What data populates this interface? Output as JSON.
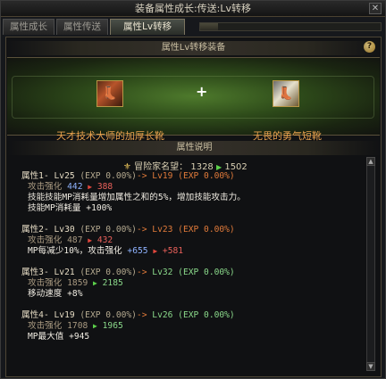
{
  "window": {
    "title": "装备属性成长:传送:Lv转移"
  },
  "tabs": [
    "属性成长",
    "属性传送",
    "属性Lv转移"
  ],
  "tab_progress": 0.1,
  "equip_section": {
    "title": "属性Lv转移装备",
    "left_item": {
      "name": "天才技术大师的加厚长靴",
      "icon": "boot-icon"
    },
    "right_item": {
      "name": "无畏的勇气短靴",
      "icon": "boot-icon"
    },
    "plus": "+"
  },
  "detail_section": {
    "title": "属性说明",
    "fame": {
      "label": "冒险家名望：",
      "from": "1328",
      "to": "1502"
    },
    "attributes": [
      {
        "head": "属性1- Lv25",
        "exp_from": "(EXP 0.00%)",
        "arrow": "->",
        "target": "Lv19 (EXP 0.00%)",
        "lines": [
          {
            "label": "攻击强化",
            "from": "442",
            "dir": "down",
            "to": "388"
          },
          {
            "text": "技能技能MP消耗量增加属性之和的5%，增加技能攻击力。"
          },
          {
            "text": "技能MP消耗量 +100%"
          }
        ]
      },
      {
        "head": "属性2- Lv30",
        "exp_from": "(EXP 0.00%)",
        "arrow": "->",
        "target": "Lv23 (EXP 0.00%)",
        "lines": [
          {
            "label": "攻击强化",
            "from": "487",
            "dir": "down",
            "to": "432"
          },
          {
            "text": "MP每减少10%，攻击强化",
            "extra_from": "+655",
            "extra_to": "+581"
          }
        ]
      },
      {
        "head": "属性3- Lv21",
        "exp_from": "(EXP 0.00%)",
        "arrow": "->",
        "target": "Lv32 (EXP 0.00%)",
        "lines": [
          {
            "label": "攻击强化",
            "from": "1859",
            "dir": "up",
            "to": "2185"
          },
          {
            "text": "移动速度 +8%"
          }
        ]
      },
      {
        "head": "属性4- Lv19",
        "exp_from": "(EXP 0.00%)",
        "arrow": "->",
        "target": "Lv26 (EXP 0.00%)",
        "lines": [
          {
            "label": "攻击强化",
            "from": "1708",
            "dir": "up",
            "to": "1965"
          },
          {
            "text": "MP最大值 +945"
          }
        ]
      }
    ]
  },
  "colors": {
    "accent_orange": "#e9a24e",
    "up": "#5cd14b",
    "down": "#e2473d"
  }
}
